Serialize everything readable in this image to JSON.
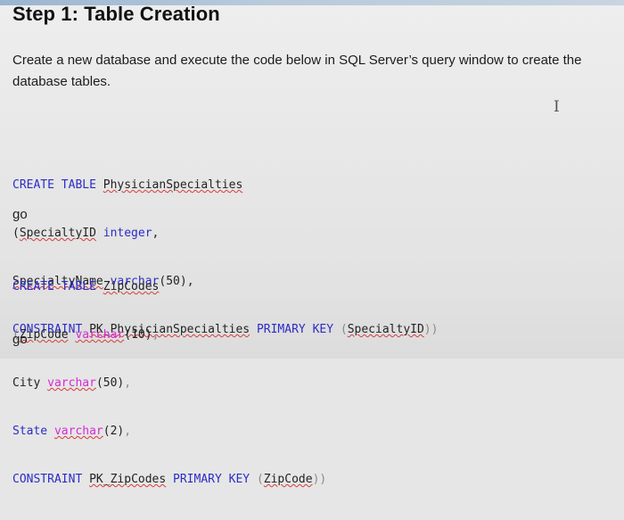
{
  "heading": "Step 1: Table Creation",
  "intro": "Create a new database and execute the code below in SQL Server’s query window to create the database tables.",
  "cursor_glyph": "I",
  "code_block_1": {
    "create": "CREATE TABLE",
    "table_name": "PhysicianSpecialties",
    "col1_paren": "(",
    "col1_name": "SpecialtyID",
    "col1_type": "integer",
    "col1_comma": ",",
    "col2_name": "SpecialtyName",
    "col2_type": "varchar",
    "col2_len": "(50)",
    "col2_comma": ",",
    "constraint": "CONSTRAINT",
    "pk_name": "PK_PhysicianSpecialties",
    "primary_key": "PRIMARY KEY",
    "pk_open": "(",
    "pk_col": "SpecialtyID",
    "pk_close": "))"
  },
  "go_1": "go",
  "code_block_2": {
    "create": "CREATE TABLE",
    "table_name": "ZipCodes",
    "col1_paren": "(",
    "col1_name": "ZipCode",
    "col1_type": "varchar",
    "col1_len": "(10)",
    "col1_comma": ",",
    "col2_name": "City",
    "col2_type": "varchar",
    "col2_len": "(50)",
    "col2_comma": ",",
    "col3_name": "State",
    "col3_type": "varchar",
    "col3_len": "(2)",
    "col3_comma": ",",
    "constraint": "CONSTRAINT",
    "pk_name": "PK_ZipCodes",
    "primary_key": "PRIMARY KEY",
    "pk_open": "(",
    "pk_col": "ZipCode",
    "pk_close": "))"
  },
  "go_2": "go",
  "colors": {
    "keyword": "#2c2cc8",
    "function": "#d62ad6",
    "text": "#222222"
  }
}
